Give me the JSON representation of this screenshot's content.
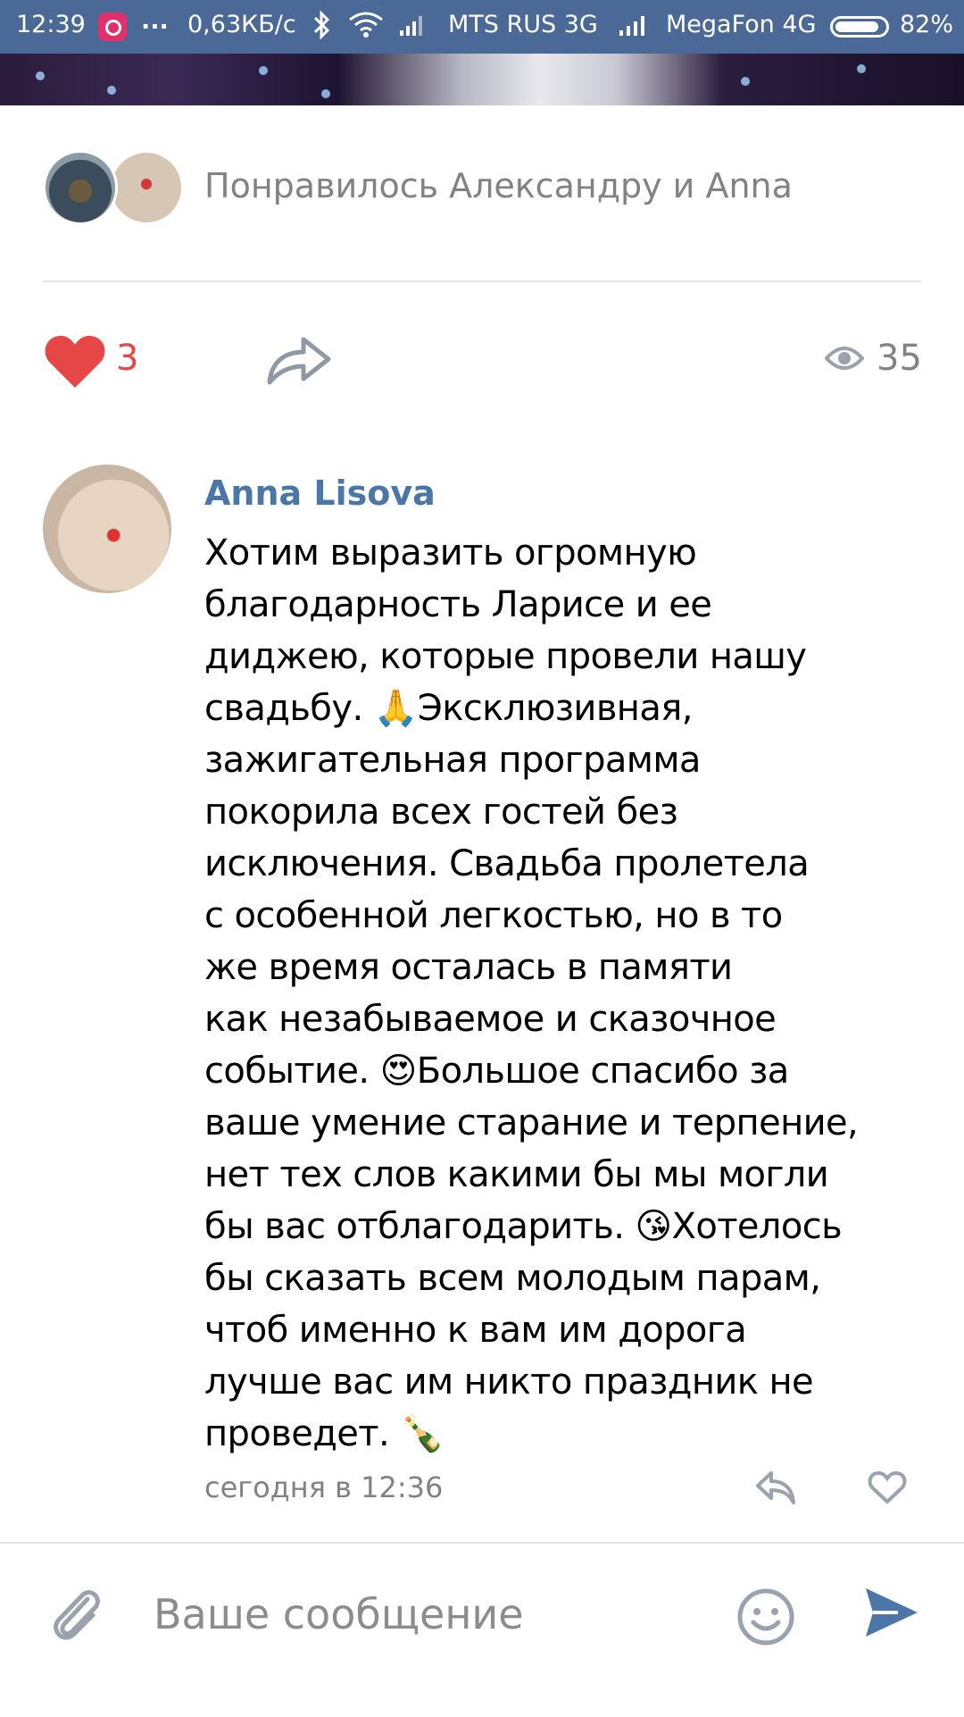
{
  "status_bar": {
    "time": "12:39",
    "dots": "...",
    "speed": "0,63КБ/с",
    "operator1": "MTS RUS 3G",
    "operator2": "MegaFon 4G",
    "battery": "82%"
  },
  "likes_summary": {
    "text": "Понравилось Александру и Anna"
  },
  "actions": {
    "likes_count": "3",
    "views_count": "35"
  },
  "comment": {
    "author": "Anna Lisova",
    "text": "Хотим выразить огромную\nблагодарность Ларисе и ее\nдиджею, которые провели нашу\nсвадьбу. 🙏Эксклюзивная,\nзажигательная программа\nпокорила всех гостей без\nисключения. Свадьба пролетела\nс особенной легкостью, но в то\nже время осталась в памяти\nкак незабываемое и сказочное\nсобытие. 😍Большое спасибо за\nваше умение старание и терпение,\nнет тех слов какими бы мы могли\nбы вас отблагодарить. 😘Хотелось\nбы сказать всем молодым парам,\nчтоб именно к вам им дорога\nлучше вас им никто праздник не\nпроведет. 🍾",
    "time": "сегодня в 12:36"
  },
  "composer": {
    "placeholder": "Ваше сообщение"
  },
  "colors": {
    "status_bar": "#4a6996",
    "link_blue": "#4a76a8",
    "like_red": "#e64646",
    "secondary_gray": "#828282"
  }
}
